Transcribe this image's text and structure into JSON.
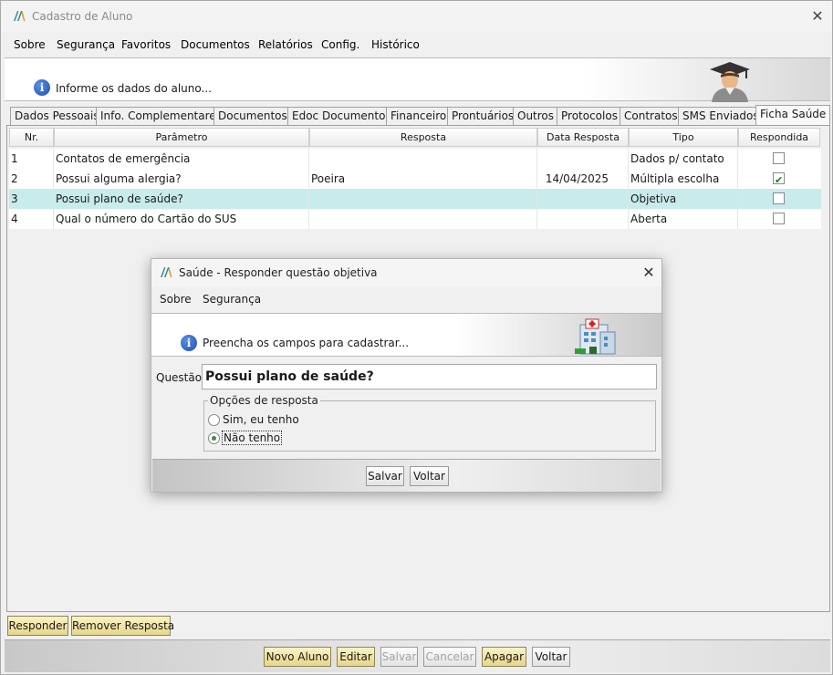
{
  "window": {
    "title": "Cadastro de Aluno"
  },
  "menu": [
    "Sobre",
    "Segurança",
    "Favoritos",
    "Documentos",
    "Relatórios",
    "Config.",
    "Histórico"
  ],
  "header": {
    "message": "Informe os dados do aluno..."
  },
  "tabs": [
    "Dados Pessoais",
    "Info. Complementares",
    "Documentos",
    "Edoc Documentos",
    "Financeiro",
    "Prontuários",
    "Outros",
    "Protocolos",
    "Contratos",
    "SMS Enviados",
    "Ficha Saúde"
  ],
  "active_tab": "Ficha Saúde",
  "grid": {
    "columns": [
      "Nr.",
      "Parâmetro",
      "Resposta",
      "Data Resposta",
      "Tipo",
      "Respondida"
    ],
    "rows": [
      {
        "nr": "1",
        "parametro": "Contatos de emergência",
        "resposta": "",
        "data": "",
        "tipo": "Dados p/ contato",
        "respondida": false
      },
      {
        "nr": "2",
        "parametro": "Possui alguma alergia?",
        "resposta": "Poeira",
        "data": "14/04/2025",
        "tipo": "Múltipla escolha",
        "respondida": true
      },
      {
        "nr": "3",
        "parametro": "Possui plano de saúde?",
        "resposta": "",
        "data": "",
        "tipo": "Objetiva",
        "respondida": false
      },
      {
        "nr": "4",
        "parametro": "Qual o número do Cartão do SUS",
        "resposta": "",
        "data": "",
        "tipo": "Aberta",
        "respondida": false
      }
    ],
    "selected_row": 3
  },
  "panel_buttons": {
    "responder": "Responder",
    "remover": "Remover Resposta"
  },
  "footer_buttons": {
    "novo": "Novo Aluno",
    "editar": "Editar",
    "salvar": "Salvar",
    "cancelar": "Cancelar",
    "apagar": "Apagar",
    "voltar": "Voltar"
  },
  "dialog": {
    "title": "Saúde - Responder questão objetiva",
    "menu": [
      "Sobre",
      "Segurança"
    ],
    "message": "Preencha os campos para cadastrar...",
    "question_label": "Questão:",
    "question": "Possui plano de saúde?",
    "options_legend": "Opções de resposta",
    "options": [
      "Sim, eu tenho",
      "Não tenho"
    ],
    "selected_option": "Não tenho",
    "buttons": {
      "salvar": "Salvar",
      "voltar": "Voltar"
    }
  },
  "colors": {
    "selected_row": "#c8ebeb",
    "yellow_button": "#f0e3a2",
    "info_icon": "#1e4fb8",
    "check": "#1a7a1a"
  }
}
